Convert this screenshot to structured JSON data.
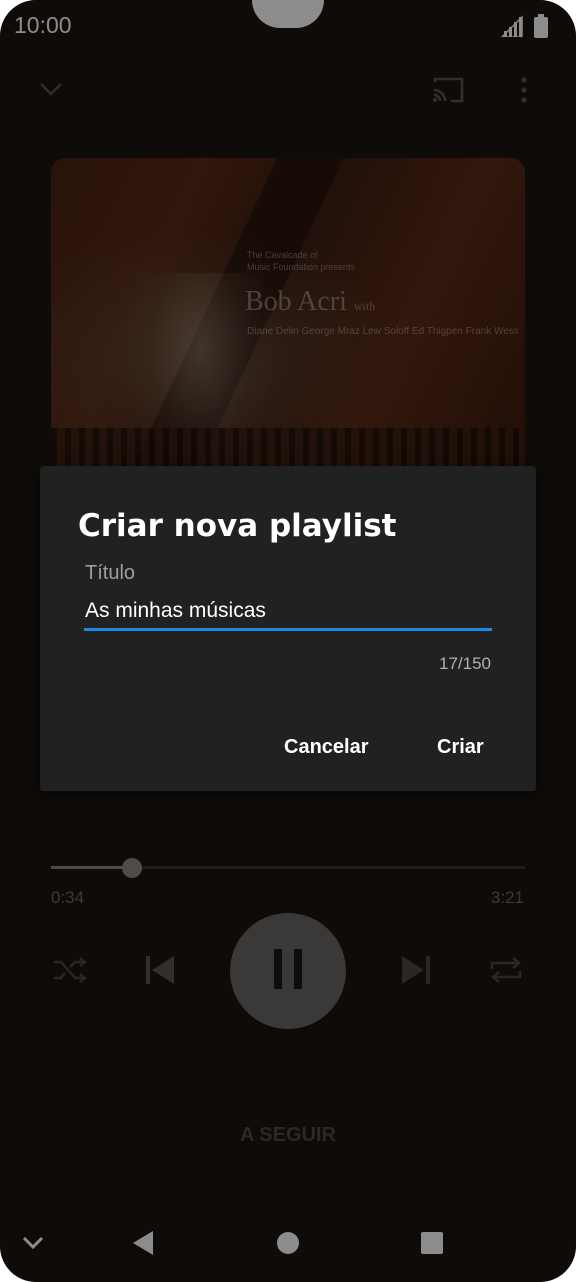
{
  "status_bar": {
    "time": "10:00"
  },
  "album_art": {
    "line1": "The Cavalcade of",
    "line2": "Music Foundation presents",
    "title": "Bob Acri",
    "title_suffix": "with",
    "names": "Diane Delin George Mraz Lew Soloff  Ed Thigpen Frank Wess"
  },
  "dialog": {
    "title": "Criar nova playlist",
    "field_label": "Título",
    "field_value": "As minhas músicas",
    "counter": "17/150",
    "cancel_label": "Cancelar",
    "create_label": "Criar",
    "accent_color": "#1e88e5"
  },
  "player": {
    "elapsed": "0:34",
    "total": "3:21",
    "progress_fraction": 0.17,
    "up_next_label": "A SEGUIR"
  },
  "icons": {
    "top": [
      "chevron-down-icon",
      "cast-icon",
      "more-vert-icon"
    ],
    "controls": [
      "shuffle-icon",
      "skip-previous-icon",
      "pause-icon",
      "skip-next-icon",
      "repeat-icon"
    ],
    "nav": [
      "chevron-down-icon",
      "back-icon",
      "home-icon",
      "recents-icon"
    ]
  }
}
